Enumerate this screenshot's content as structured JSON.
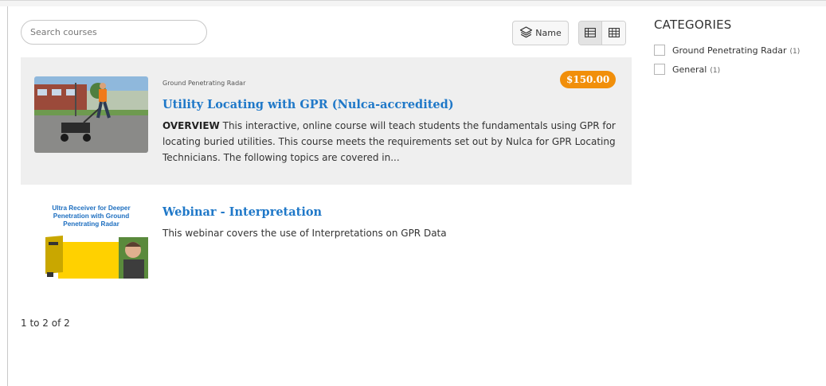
{
  "search": {
    "placeholder": "Search courses"
  },
  "toolbar": {
    "sort_label": "Name"
  },
  "courses": [
    {
      "category": "Ground Penetrating Radar",
      "price": "$150.00",
      "title": "Utility Locating with GPR (Nulca-accredited)",
      "desc_bold": "OVERVIEW",
      "desc_text": " This interactive, online course will teach students the fundamentals using GPR for locating buried utilities. This course meets the requirements set out by Nulca for GPR Locating Technicians. The following topics are covered in..."
    },
    {
      "thumb_text": "Ultra Receiver for Deeper Penetration with Ground Penetrating Radar",
      "title": "Webinar - Interpretation",
      "desc_text": "This webinar covers the use of Interpretations on GPR Data"
    }
  ],
  "pagination": "1 to 2 of 2",
  "categories": {
    "heading": "CATEGORIES",
    "items": [
      {
        "label": "Ground Penetrating Radar",
        "count": "(1)"
      },
      {
        "label": "General",
        "count": "(1)"
      }
    ]
  },
  "colors": {
    "price_badge": "#f18f0b",
    "title_link": "#1f78c8",
    "thumb_text": "#1e6fc0",
    "thumb_yellow": "#ffd100"
  }
}
